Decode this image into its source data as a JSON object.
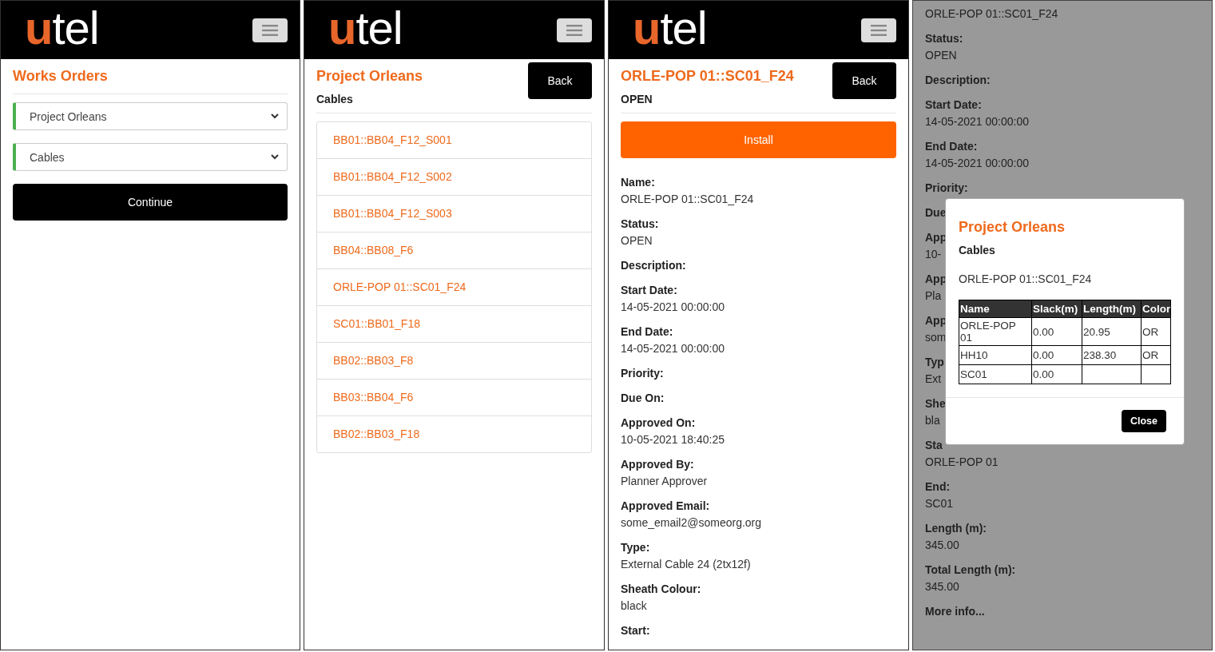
{
  "screens": [
    {
      "kind": "select",
      "header": {
        "logo_accent": "u",
        "logo_rest": "tel"
      },
      "title": "Works Orders",
      "selects": [
        {
          "value": "Project Orleans"
        },
        {
          "value": "Cables"
        }
      ],
      "button": "Continue"
    },
    {
      "kind": "list",
      "header": {
        "logo_accent": "u",
        "logo_rest": "tel"
      },
      "title": "Project Orleans",
      "subtitle": "Cables",
      "back": "Back",
      "items": [
        "BB01::BB04_F12_S001",
        "BB01::BB04_F12_S002",
        "BB01::BB04_F12_S003",
        "BB04::BB08_F6",
        "ORLE-POP 01::SC01_F24",
        "SC01::BB01_F18",
        "BB02::BB03_F8",
        "BB03::BB04_F6",
        "BB02::BB03_F18"
      ]
    },
    {
      "kind": "detail",
      "header": {
        "logo_accent": "u",
        "logo_rest": "tel"
      },
      "title": "ORLE-POP 01::SC01_F24",
      "subtitle": "OPEN",
      "back": "Back",
      "action": "Install",
      "fields": [
        {
          "label": "Name:",
          "value": "ORLE-POP 01::SC01_F24"
        },
        {
          "label": "Status:",
          "value": "OPEN"
        },
        {
          "label": "Description:"
        },
        {
          "label": "Start Date:",
          "value": "14-05-2021 00:00:00"
        },
        {
          "label": "End Date:",
          "value": "14-05-2021 00:00:00"
        },
        {
          "label": "Priority:"
        },
        {
          "label": "Due On:"
        },
        {
          "label": "Approved On:",
          "value": "10-05-2021 18:40:25"
        },
        {
          "label": "Approved By:",
          "value": "Planner Approver"
        },
        {
          "label": "Approved Email:",
          "value": "some_email2@someorg.org"
        },
        {
          "label": "Type:",
          "value": "External Cable 24 (2tx12f)"
        },
        {
          "label": "Sheath Colour:",
          "value": "black"
        },
        {
          "label": "Start:"
        }
      ]
    },
    {
      "kind": "dimmed",
      "fields": [
        {
          "value": "ORLE-POP 01::SC01_F24"
        },
        {
          "label": "Status:",
          "value": "OPEN"
        },
        {
          "label": "Description:"
        },
        {
          "label": "Start Date:",
          "value": "14-05-2021 00:00:00"
        },
        {
          "label": "End Date:",
          "value": "14-05-2021 00:00:00"
        },
        {
          "label": "Priority:"
        },
        {
          "label": "Due"
        },
        {
          "label": "App",
          "value": "10-"
        },
        {
          "label": "App",
          "value": "Pla"
        },
        {
          "label": "App",
          "value": "som"
        },
        {
          "label": "Typ",
          "value": "Ext"
        },
        {
          "label": "She",
          "value": "bla"
        },
        {
          "label": "Sta",
          "value": "ORLE-POP 01"
        },
        {
          "label": "End:",
          "value": "SC01"
        },
        {
          "label": "Length (m):",
          "value": "345.00"
        },
        {
          "label": "Total Length (m):",
          "value": "345.00"
        },
        {
          "label": "More info..."
        }
      ],
      "modal": {
        "title": "Project Orleans",
        "subtitle": "Cables",
        "name": "ORLE-POP 01::SC01_F24",
        "columns": [
          "Name",
          "Slack(m)",
          "Length(m)",
          "Color"
        ],
        "rows": [
          [
            "ORLE-POP 01",
            "0.00",
            "20.95",
            "OR"
          ],
          [
            "HH10",
            "0.00",
            "238.30",
            "OR"
          ],
          [
            "SC01",
            "0.00",
            "",
            ""
          ]
        ],
        "close": "Close"
      }
    }
  ]
}
